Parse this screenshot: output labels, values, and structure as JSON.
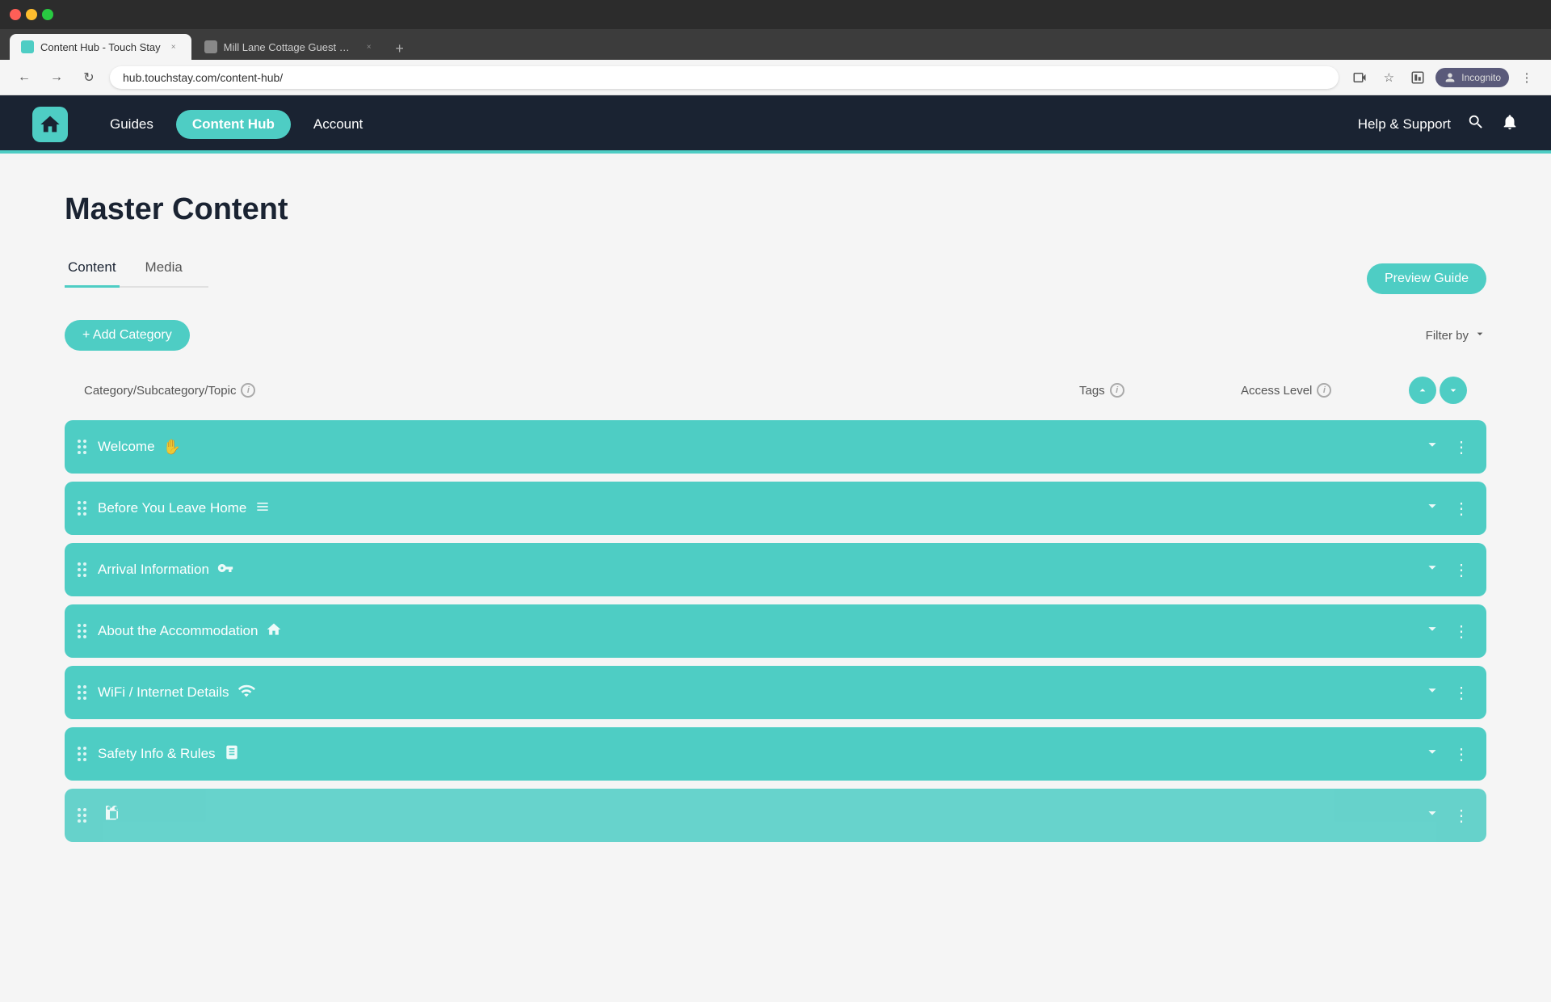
{
  "browser": {
    "tabs": [
      {
        "id": "tab1",
        "title": "Content Hub - Touch Stay",
        "active": true,
        "favicon": "content-hub"
      },
      {
        "id": "tab2",
        "title": "Mill Lane Cottage Guest Welco...",
        "active": false,
        "favicon": "mill"
      }
    ],
    "address": "hub.touchstay.com/content-hub/",
    "incognito_label": "Incognito"
  },
  "nav": {
    "logo_aria": "Touch Stay Home",
    "links": [
      {
        "id": "guides",
        "label": "Guides",
        "active": false
      },
      {
        "id": "content-hub",
        "label": "Content Hub",
        "active": true
      },
      {
        "id": "account",
        "label": "Account",
        "active": false
      }
    ],
    "help_label": "Help & Support",
    "search_aria": "Search",
    "bell_aria": "Notifications"
  },
  "page": {
    "title": "Master Content",
    "tabs": [
      {
        "id": "content",
        "label": "Content",
        "active": true
      },
      {
        "id": "media",
        "label": "Media",
        "active": false
      }
    ],
    "preview_guide_btn": "Preview Guide",
    "add_category_btn": "+ Add Category",
    "filter_by_label": "Filter by",
    "table_headers": {
      "category": "Category/Subcategory/Topic",
      "tags": "Tags",
      "access_level": "Access Level"
    },
    "categories": [
      {
        "id": "welcome",
        "name": "Welcome",
        "icon": "✋"
      },
      {
        "id": "before-you-leave",
        "name": "Before You Leave Home",
        "icon": "≡"
      },
      {
        "id": "arrival-info",
        "name": "Arrival Information",
        "icon": "🔑"
      },
      {
        "id": "about-accommodation",
        "name": "About the Accommodation",
        "icon": "🏠"
      },
      {
        "id": "wifi",
        "name": "WiFi / Internet Details",
        "icon": "📶"
      },
      {
        "id": "safety",
        "name": "Safety Info & Rules",
        "icon": "📖"
      },
      {
        "id": "more",
        "name": "",
        "icon": ""
      }
    ]
  },
  "icons": {
    "back": "←",
    "forward": "→",
    "refresh": "↻",
    "close_tab": "×",
    "add_tab": "+",
    "star": "☆",
    "menu": "⋮",
    "chevron_down": "∨",
    "chevron_up": "∧",
    "more_vert": "⋮"
  }
}
